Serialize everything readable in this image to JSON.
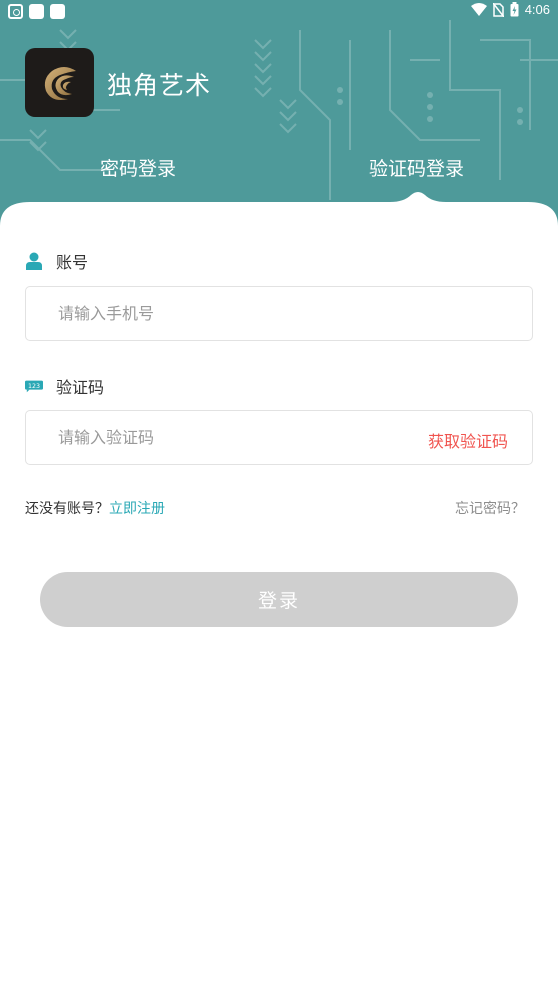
{
  "status_bar": {
    "time": "4:06",
    "icons": [
      "notification-app-icon",
      "notification-square-icon",
      "notification-square-icon",
      "wifi-icon",
      "no-sim-icon",
      "battery-charging-icon"
    ]
  },
  "app": {
    "name": "独角艺术",
    "logo": "eagle-logo"
  },
  "tabs": [
    {
      "label": "密码登录",
      "active": false
    },
    {
      "label": "验证码登录",
      "active": true
    }
  ],
  "account": {
    "label": "账号",
    "icon": "user-icon",
    "placeholder": "请输入手机号",
    "value": ""
  },
  "verify": {
    "label": "验证码",
    "icon": "number-code-icon",
    "placeholder": "请输入验证码",
    "value": "",
    "get_code_label": "获取验证码"
  },
  "register": {
    "prompt": "还没有账号？",
    "link": "立即注册"
  },
  "forgot_label": "忘记密码？",
  "login_label": "登录",
  "colors": {
    "header_bg": "#4e9a9a",
    "accent_teal": "#2aa8b5",
    "accent_red": "#f0544f",
    "button_disabled": "#cfcfcf"
  }
}
